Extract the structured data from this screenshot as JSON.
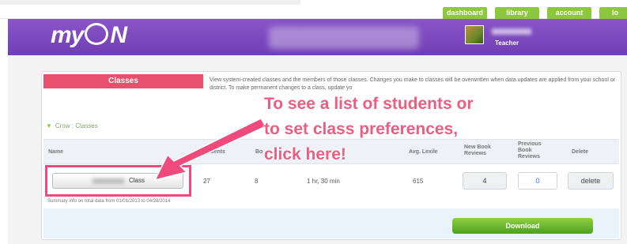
{
  "nav": {
    "items": [
      {
        "label": "dashboard"
      },
      {
        "label": "library"
      },
      {
        "label": "account"
      },
      {
        "label": "lo"
      }
    ]
  },
  "header": {
    "logo_text_left": "my",
    "logo_text_right": "N",
    "role": "Teacher"
  },
  "section": {
    "title": "Classes",
    "description": "View system-created classes and the members of those classes. Changes you make to classes will be overwritten when data updates are applied from your school or district. To make permanent changes to a class, update yo",
    "breadcrumb": "Crow : Classes"
  },
  "table": {
    "headers": {
      "name": "Name",
      "students": "Students",
      "books": "Bo",
      "avg_lexile": "Avg. Lexile",
      "new_reviews": "New Book Reviews",
      "prev_reviews": "Previous Book Reviews",
      "delete": "Delete"
    },
    "row": {
      "class_label": "Class",
      "students": "27",
      "books": "8",
      "time": "1 hr, 30 min",
      "avg_lexile": "615",
      "new_reviews": "4",
      "prev_reviews": "0",
      "delete_label": "delete"
    },
    "footnote": "Summary info on total data from 01/01/2013 to 04/28/2014"
  },
  "download": {
    "label": "Download"
  },
  "overlay": {
    "line1": "To see a list of students or",
    "line2": "to set class preferences,",
    "line3": "click here!"
  },
  "colors": {
    "header_purple": "#7a46bd",
    "accent_pink": "#ea5e82",
    "nav_green": "#8dc63f",
    "download_green": "#5aac24"
  }
}
